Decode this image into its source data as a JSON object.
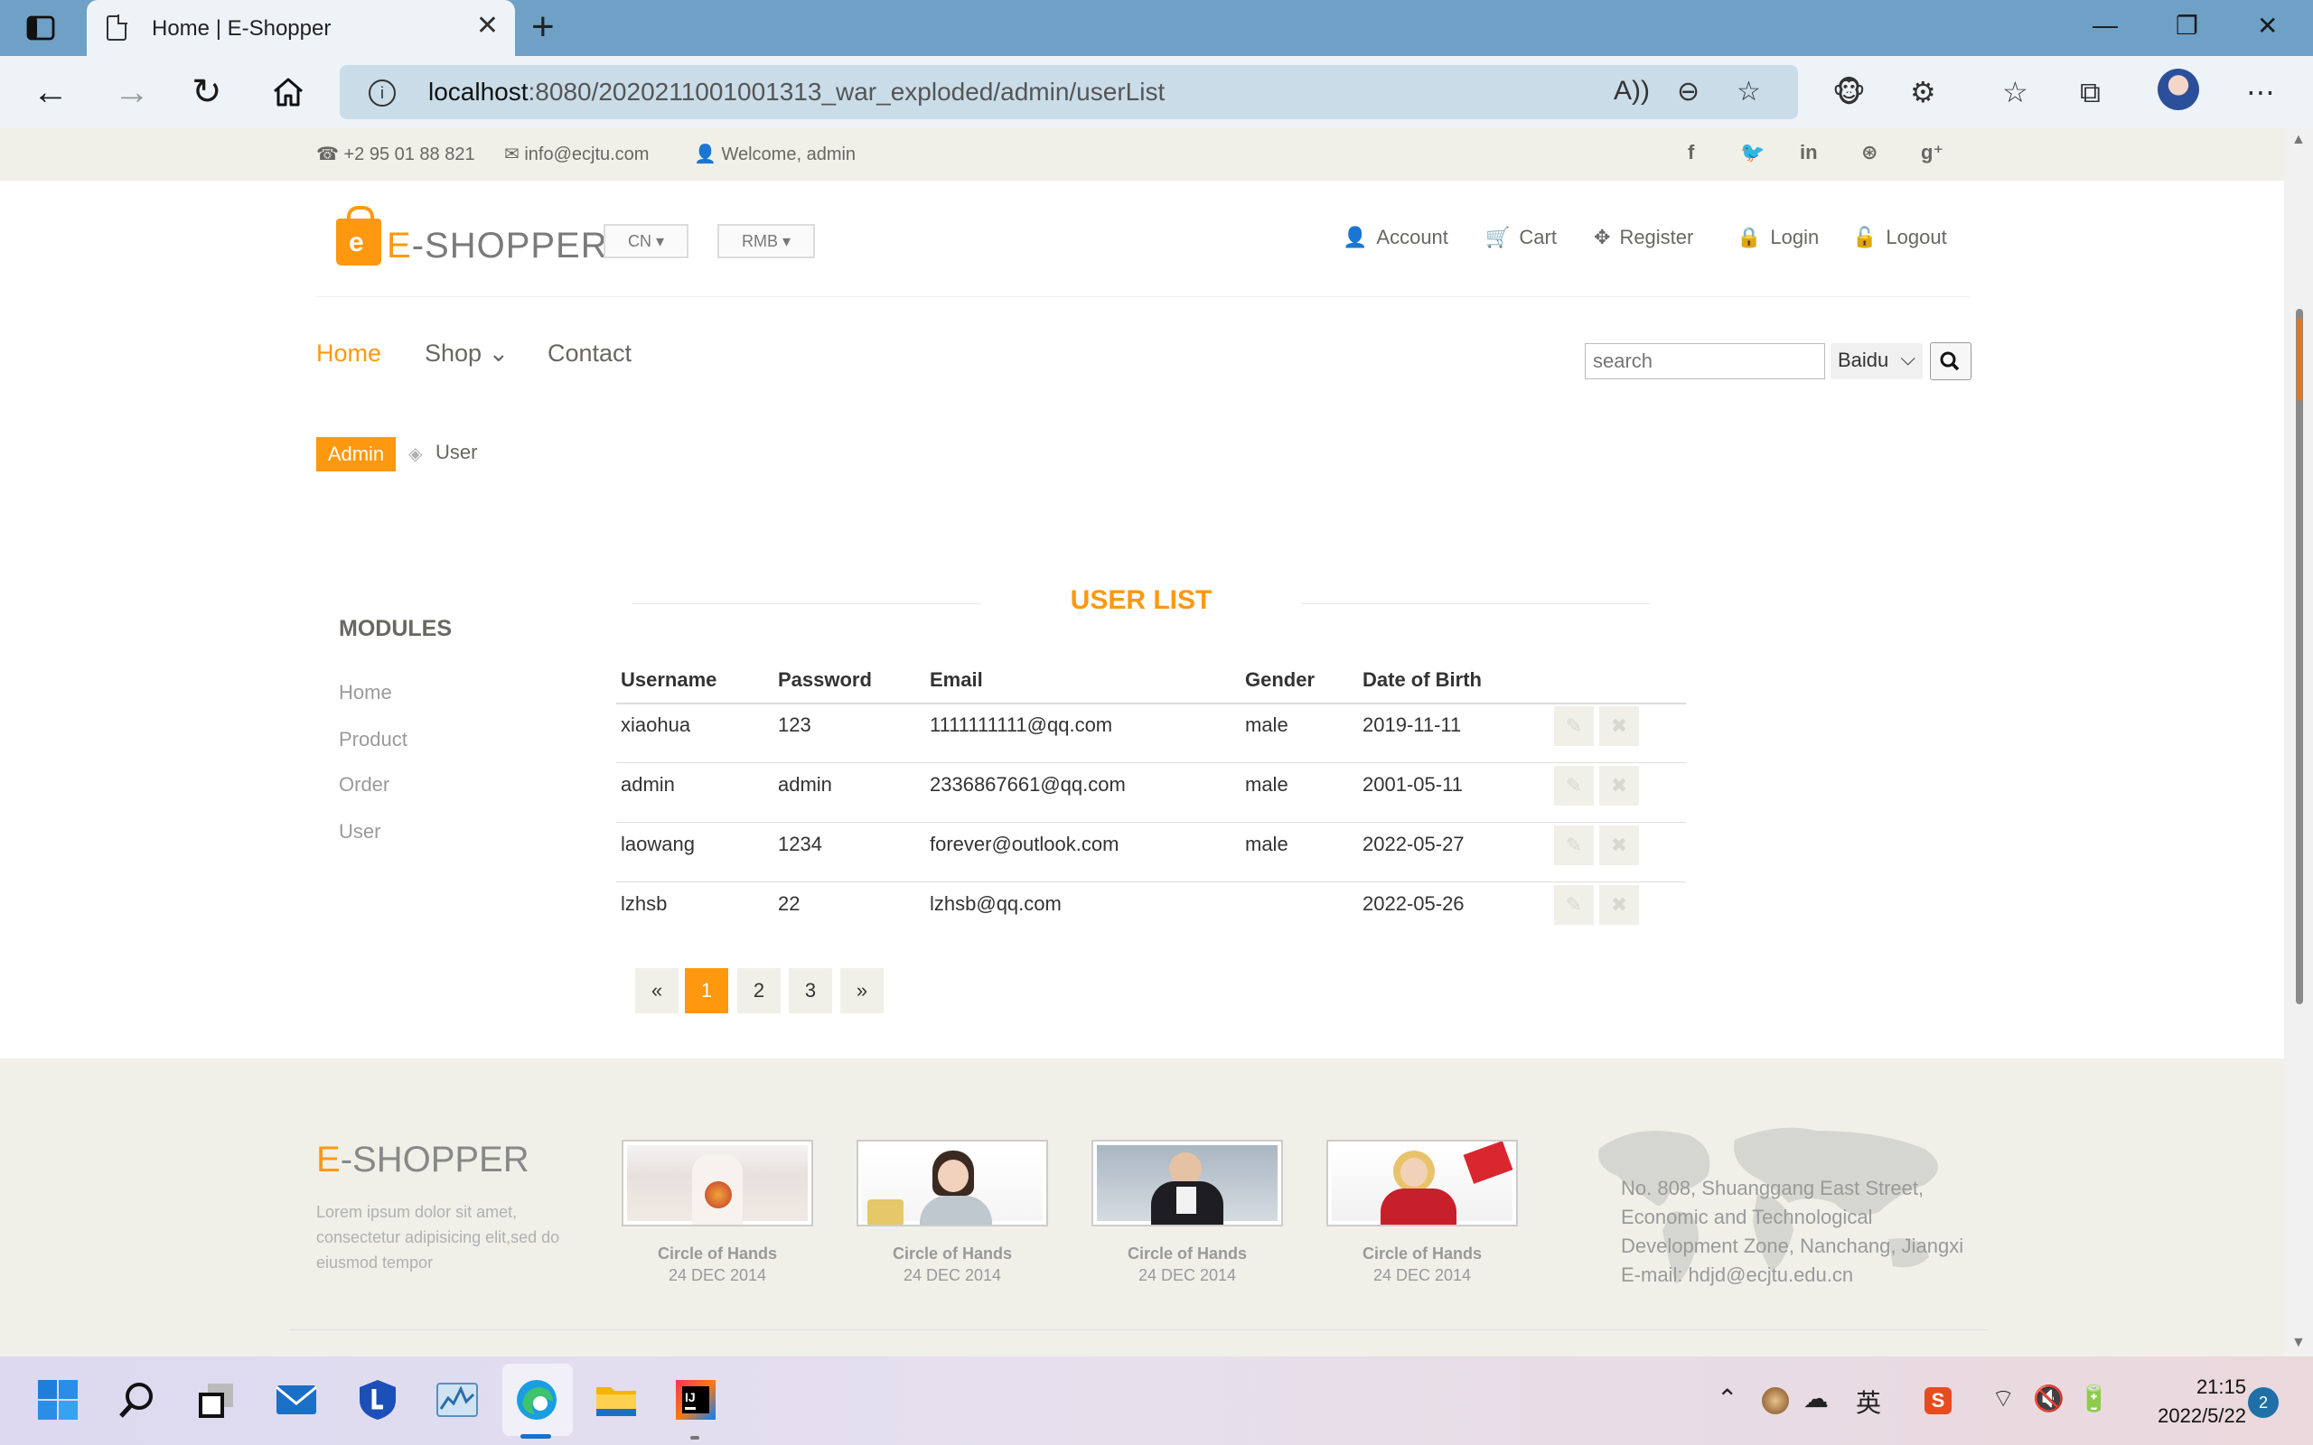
{
  "browser": {
    "tab_title": "Home | E-Shopper",
    "url_host": "localhost",
    "url_rest": ":8080/2020211001001313_war_exploded/admin/userList"
  },
  "topbar": {
    "phone": "+2 95 01 88 821",
    "email": "info@ecjtu.com",
    "welcome": "Welcome, admin"
  },
  "header": {
    "logo_e": "E",
    "logo_rest": "-SHOPPER",
    "lang": "CN ▾",
    "currency": "RMB ▾",
    "menu": [
      "Account",
      "Cart",
      "Register",
      "Login",
      "Logout"
    ]
  },
  "nav": {
    "home": "Home",
    "shop": "Shop ⌄",
    "contact": "Contact",
    "search_placeholder": "search",
    "engine": "Baidu"
  },
  "breadcrumb": {
    "admin": "Admin",
    "current": "User"
  },
  "sidebar": {
    "title": "MODULES",
    "items": [
      "Home",
      "Product",
      "Order",
      "User"
    ]
  },
  "main": {
    "title": "USER LIST",
    "columns": [
      "Username",
      "Password",
      "Email",
      "Gender",
      "Date of Birth"
    ],
    "rows": [
      [
        "xiaohua",
        "123",
        "1111111111@qq.com",
        "male",
        "2019-11-11"
      ],
      [
        "admin",
        "admin",
        "2336867661@qq.com",
        "male",
        "2001-05-11"
      ],
      [
        "laowang",
        "1234",
        "forever@outlook.com",
        "male",
        "2022-05-27"
      ],
      [
        "lzhsb",
        "22",
        "lzhsb@qq.com",
        "",
        "2022-05-26"
      ]
    ],
    "pagination": [
      "«",
      "1",
      "2",
      "3",
      "»"
    ],
    "current_page": "1"
  },
  "footer": {
    "logo_e": "E",
    "logo_rest": "-SHOPPER",
    "lorem": "Lorem ipsum dolor sit amet, consectetur adipisicing elit,sed do eiusmod tempor",
    "videos": [
      {
        "title": "Circle of Hands",
        "date": "24 DEC 2014"
      },
      {
        "title": "Circle of Hands",
        "date": "24 DEC 2014"
      },
      {
        "title": "Circle of Hands",
        "date": "24 DEC 2014"
      },
      {
        "title": "Circle of Hands",
        "date": "24 DEC 2014"
      }
    ],
    "address": [
      "No. 808, Shuanggang East Street,",
      "Economic and Technological",
      "Development Zone, Nanchang, Jiangxi",
      "E-mail: hdjd@ecjtu.edu.cn"
    ]
  },
  "taskbar": {
    "time": "21:15",
    "date": "2022/5/22",
    "notifications": "2",
    "ime": "英"
  },
  "colors": {
    "accent": "#FE980F",
    "text": "#696763",
    "strip": "#F0F0E9"
  }
}
